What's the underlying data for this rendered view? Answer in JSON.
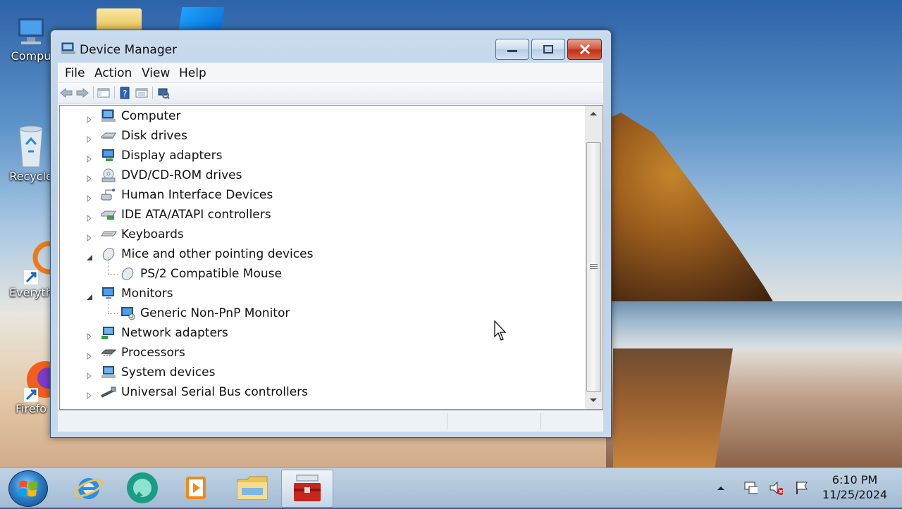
{
  "desktop": {
    "icons": [
      {
        "label": "Compu"
      },
      {
        "label": "Recycle"
      },
      {
        "label": "Everyth"
      },
      {
        "label": "Firefo"
      }
    ]
  },
  "window": {
    "title": "Device Manager",
    "menu": [
      "File",
      "Action",
      "View",
      "Help"
    ],
    "tree": [
      {
        "label": "Computer",
        "expanded": false
      },
      {
        "label": "Disk drives",
        "expanded": false
      },
      {
        "label": "Display adapters",
        "expanded": false
      },
      {
        "label": "DVD/CD-ROM drives",
        "expanded": false
      },
      {
        "label": "Human Interface Devices",
        "expanded": false
      },
      {
        "label": "IDE ATA/ATAPI controllers",
        "expanded": false
      },
      {
        "label": "Keyboards",
        "expanded": false
      },
      {
        "label": "Mice and other pointing devices",
        "expanded": true
      },
      {
        "label": "PS/2 Compatible Mouse",
        "child": true
      },
      {
        "label": "Monitors",
        "expanded": true
      },
      {
        "label": "Generic Non-PnP Monitor",
        "child": true
      },
      {
        "label": "Network adapters",
        "expanded": false
      },
      {
        "label": "Processors",
        "expanded": false
      },
      {
        "label": "System devices",
        "expanded": false
      },
      {
        "label": "Universal Serial Bus controllers",
        "expanded": false
      }
    ]
  },
  "taskbar": {
    "clock_time": "6:10 PM",
    "clock_date": "11/25/2024"
  },
  "colors": {
    "accent": "#3b6ea5",
    "close_red": "#c1301a"
  }
}
